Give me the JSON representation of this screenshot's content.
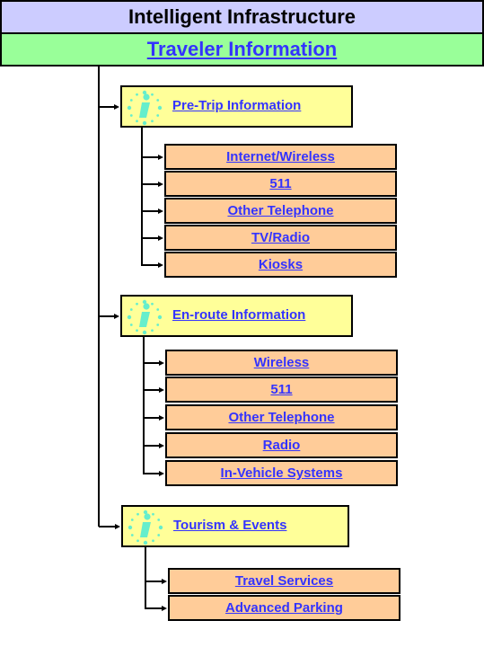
{
  "header": {
    "title": "Intelligent Infrastructure",
    "subtitle": "Traveler Information"
  },
  "colors": {
    "title_bg": "#ccccff",
    "subtitle_bg": "#99ff99",
    "category_bg": "#ffff99",
    "item_bg": "#ffcc99",
    "link": "#3333ff",
    "info_icon": "#66eecc"
  },
  "categories": [
    {
      "label": "Pre-Trip Information",
      "icon": "info-icon",
      "items": [
        "Internet/Wireless",
        "511",
        "Other Telephone",
        "TV/Radio",
        "Kiosks"
      ]
    },
    {
      "label": "En-route Information",
      "icon": "info-icon",
      "items": [
        "Wireless",
        "511",
        "Other Telephone",
        "Radio",
        "In-Vehicle Systems"
      ]
    },
    {
      "label": "Tourism & Events",
      "icon": "info-icon",
      "items": [
        "Travel Services",
        "Advanced Parking"
      ]
    }
  ]
}
